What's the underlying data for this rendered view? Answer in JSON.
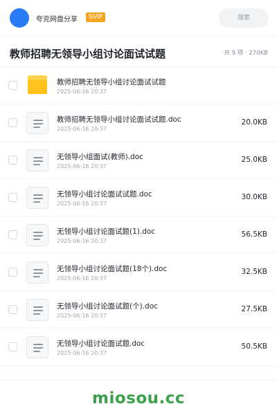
{
  "header": {
    "app_name": "夸克网盘分享",
    "badge": "SVIP",
    "search_label": "搜索",
    "avatar_color": "#2a7bf6",
    "badge_color": "#f5a623"
  },
  "folder": {
    "title": "教师招聘无领导小组讨论面试试题",
    "summary": "共 9 项 · 270KB"
  },
  "files": [
    {
      "icon": "folder-icon",
      "name": "教师招聘无领导小组讨论面试试题",
      "date": "2025-06-16 20:37",
      "size": ""
    },
    {
      "icon": "document-icon",
      "name": "教师招聘无领导小组讨论面试试题.doc",
      "date": "2025-06-16 20:37",
      "size": "20.0KB"
    },
    {
      "icon": "document-icon",
      "name": "无领导小组面试(教师).doc",
      "date": "2025-06-16 20:37",
      "size": "25.0KB"
    },
    {
      "icon": "document-icon",
      "name": "无领导小组讨论面试试题.doc",
      "date": "2025-06-16 20:37",
      "size": "30.0KB"
    },
    {
      "icon": "document-icon",
      "name": "无领导小组讨论面试题(1).doc",
      "date": "2025-06-16 20:37",
      "size": "56.5KB"
    },
    {
      "icon": "document-icon",
      "name": "无领导小组讨论面试题(18个).doc",
      "date": "2025-06-16 20:37",
      "size": "32.5KB"
    },
    {
      "icon": "document-icon",
      "name": "无领导小组讨论面试题(个).doc",
      "date": "2025-06-16 20:37",
      "size": "27.5KB"
    },
    {
      "icon": "document-icon",
      "name": "无领导小组讨论面试题.doc",
      "date": "2025-06-16 20:37",
      "size": "50.5KB"
    }
  ],
  "footer": {
    "watermark": "miosou.cc",
    "watermark_color": "#3aa14a"
  }
}
